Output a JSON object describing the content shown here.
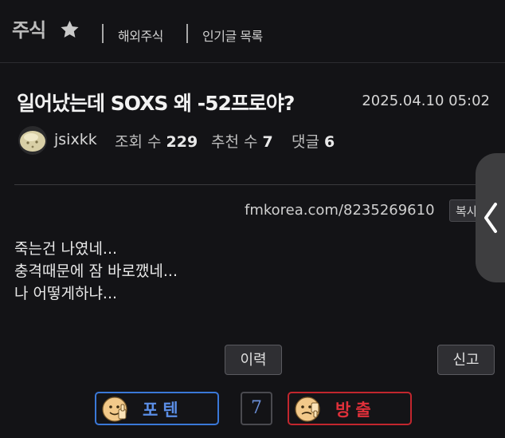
{
  "header": {
    "board_name": "주식",
    "links": [
      "해외주식",
      "인기글 목록"
    ]
  },
  "post": {
    "title": "일어났는데 SOXS 왜 -52프로야?",
    "datetime": "2025.04.10 05:02",
    "author": "jsixkk",
    "views_label": "조회 수",
    "views": "229",
    "recommends_label": "추천 수",
    "recommends": "7",
    "comments_label": "댓글",
    "comments": "6",
    "url": "fmkorea.com/8235269610",
    "copy_label": "복사",
    "body_lines": [
      "죽는건 나였네...",
      "충격때문에 잠 바로깼네...",
      "나 어떻게하냐..."
    ]
  },
  "actions": {
    "history_label": "이력",
    "report_label": "신고"
  },
  "vote": {
    "up_label": "포텐",
    "down_label": "방출",
    "count": "7"
  },
  "colors": {
    "background": "#131316",
    "vote_up": "#3a78d8",
    "vote_down": "#c2262e"
  },
  "icons": {
    "favorite": "star-icon",
    "side_tab": "chevron-left-icon"
  }
}
